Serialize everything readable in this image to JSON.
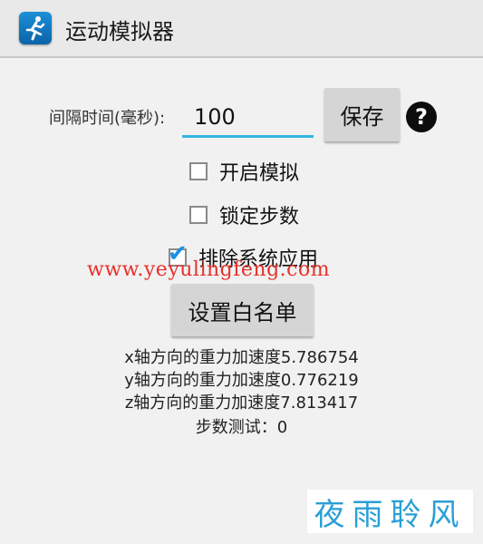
{
  "app": {
    "title": "运动模拟器",
    "icon": "running-person-icon"
  },
  "interval": {
    "label": "间隔时间(毫秒):",
    "value": "100"
  },
  "buttons": {
    "save": "保存",
    "whitelist": "设置白名单"
  },
  "help_icon": {
    "icon": "question-circle-icon",
    "glyph": "?"
  },
  "checkboxes": [
    {
      "label": "开启模拟",
      "checked": false
    },
    {
      "label": "锁定步数",
      "checked": false
    },
    {
      "label": "排除系统应用",
      "checked": true
    }
  ],
  "watermark": "www.yeyulingfeng.com",
  "accel": {
    "x": "x轴方向的重力加速度5.786754",
    "y": "y轴方向的重力加速度0.776219",
    "z": "z轴方向的重力加速度7.813417"
  },
  "step_test": "步数测试：0",
  "brand": "夜雨聆风",
  "colors": {
    "accent": "#33b5e5",
    "check": "#1a8fe0",
    "watermark": "#e7302b",
    "brand": "#2a9fd6"
  }
}
